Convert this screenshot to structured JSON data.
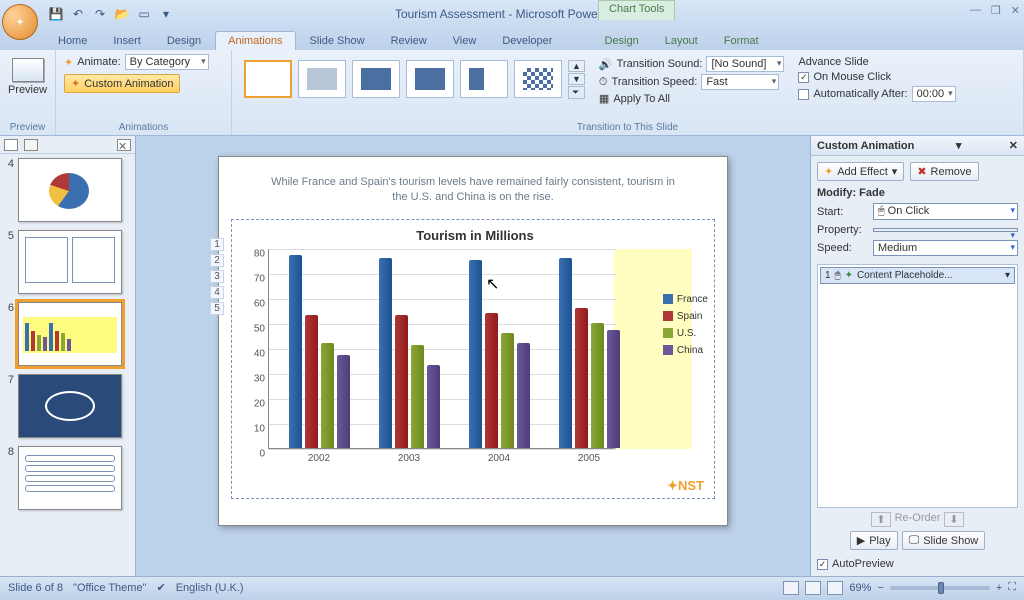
{
  "title": "Tourism Assessment - Microsoft PowerPoint",
  "context_tab": "Chart Tools",
  "tabs": [
    "Home",
    "Insert",
    "Design",
    "Animations",
    "Slide Show",
    "Review",
    "View",
    "Developer",
    "Design",
    "Layout",
    "Format"
  ],
  "active_tab": "Animations",
  "ribbon": {
    "preview_label": "Preview",
    "preview_group": "Preview",
    "animate_label": "Animate:",
    "animate_value": "By Category",
    "custom_anim": "Custom Animation",
    "animations_group": "Animations",
    "trans_sound_label": "Transition Sound:",
    "trans_sound_value": "[No Sound]",
    "trans_speed_label": "Transition Speed:",
    "trans_speed_value": "Fast",
    "apply_all": "Apply To All",
    "trans_group": "Transition to This Slide",
    "adv_title": "Advance Slide",
    "adv_click": "On Mouse Click",
    "adv_after": "Automatically After:",
    "adv_after_val": "00:00"
  },
  "thumbs": [
    4,
    5,
    6,
    7,
    8
  ],
  "selected_thumb": 6,
  "slide": {
    "caption": "While France and Spain's tourism levels have remained fairly consistent, tourism in the U.S. and China is on the rise.",
    "anim_nums": [
      "1",
      "2",
      "3",
      "4",
      "5"
    ]
  },
  "chart_data": {
    "type": "bar",
    "title": "Tourism in Millions",
    "categories": [
      "2002",
      "2003",
      "2004",
      "2005"
    ],
    "series": [
      {
        "name": "France",
        "color": "#3a6fb0",
        "values": [
          77,
          76,
          75,
          76
        ]
      },
      {
        "name": "Spain",
        "color": "#b03838",
        "values": [
          53,
          53,
          54,
          56
        ]
      },
      {
        "name": "U.S.",
        "color": "#8aa838",
        "values": [
          42,
          41,
          46,
          50
        ]
      },
      {
        "name": "China",
        "color": "#6a5a9a",
        "values": [
          37,
          33,
          42,
          47
        ]
      }
    ],
    "ylim": [
      0,
      80
    ],
    "yticks": [
      0,
      10,
      20,
      30,
      40,
      50,
      60,
      70,
      80
    ]
  },
  "task_pane": {
    "title": "Custom Animation",
    "add_effect": "Add Effect",
    "remove": "Remove",
    "modify": "Modify: Fade",
    "start_label": "Start:",
    "start_value": "On Click",
    "property_label": "Property:",
    "speed_label": "Speed:",
    "speed_value": "Medium",
    "item": "Content Placeholde...",
    "reorder": "Re-Order",
    "play": "Play",
    "slideshow": "Slide Show",
    "autopreview": "AutoPreview"
  },
  "status": {
    "slide": "Slide 6 of 8",
    "theme": "\"Office Theme\"",
    "lang": "English (U.K.)",
    "zoom": "69%"
  }
}
